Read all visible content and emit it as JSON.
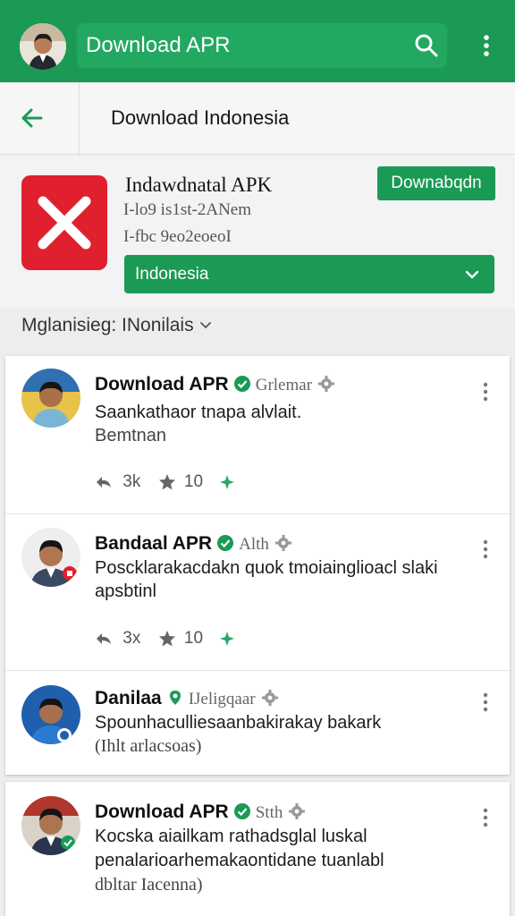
{
  "topbar": {
    "title": "Download APR"
  },
  "subbar": {
    "title": "Download Indonesia"
  },
  "app": {
    "name": "Indawdnatal APK",
    "meta1": "I-lo9 is1st-2ANem",
    "meta2": "I-fbc 9eo2eoeoI",
    "download_label": "Downabqdn",
    "language_value": "Indonesia"
  },
  "filter": {
    "label": "Mglanisieg: INonilais"
  },
  "posts": [
    {
      "name": "Download APR",
      "handle": "Grlemar",
      "line1": "Saankathaor tnapa alvlait.",
      "line2": "Bemtnan",
      "shares": "3k",
      "stars": "10"
    },
    {
      "name": "Bandaal APR",
      "handle": "Alth",
      "line1": "Poscklarakacdakn quok tmoiainglioacl slaki",
      "line2": "apsbtinl",
      "shares": "3x",
      "stars": "10"
    },
    {
      "name": "Danilaa",
      "handle": "IJeligqaar",
      "line1": "Spounhaculliesaanbakirakay bakark",
      "line2": "(Ihlt arlacsoas)"
    },
    {
      "name": "Download APR",
      "handle": "Stth",
      "line1": "Kocska aiailkam rathadsglal luskal",
      "line2": "penalarioarhemakaontidane tuanlabl",
      "line3": "dbltar Iacenna)"
    }
  ],
  "colors": {
    "brand_green": "#1a9a55",
    "icon_red": "#e0202e",
    "verify_green": "#1a9a55"
  }
}
